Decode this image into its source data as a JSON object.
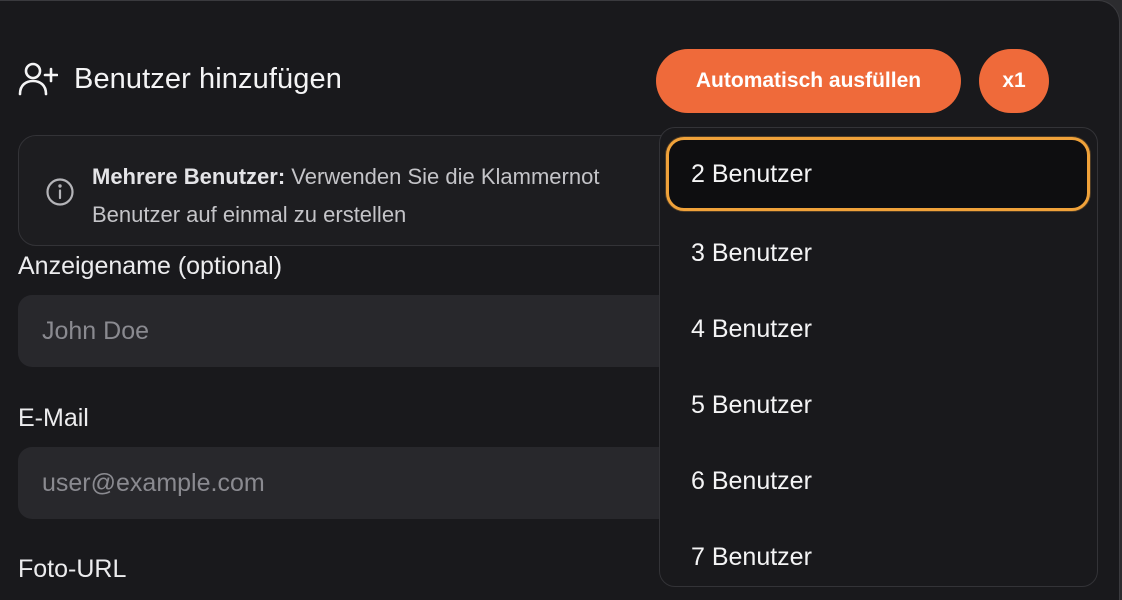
{
  "header": {
    "title": "Benutzer hinzufügen",
    "icon": "user-plus-icon"
  },
  "actions": {
    "autofill_label": "Automatisch ausfüllen",
    "count_label": "x1"
  },
  "info": {
    "bold": "Mehrere Benutzer:",
    "text": " Verwenden Sie die Klammernot",
    "line2": "Benutzer auf einmal zu erstellen"
  },
  "form": {
    "display_name_label": "Anzeigename (optional)",
    "display_name_placeholder": "John Doe",
    "email_label": "E-Mail",
    "email_placeholder": "user@example.com",
    "photo_label": "Foto-URL"
  },
  "dropdown": {
    "options": [
      "2 Benutzer",
      "3 Benutzer",
      "4 Benutzer",
      "5 Benutzer",
      "6 Benutzer",
      "7 Benutzer"
    ],
    "selected": "2 Benutzer"
  },
  "colors": {
    "accent": "#ef6a3a",
    "focus_ring": "#f0a23a",
    "background": "#19191c"
  }
}
